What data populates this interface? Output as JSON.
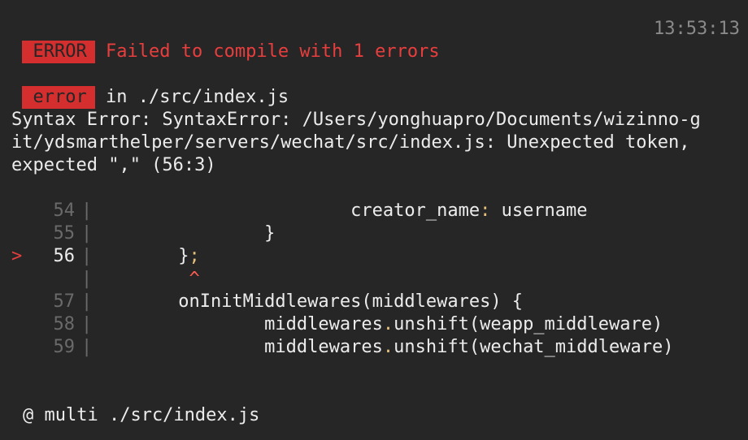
{
  "header": {
    "badge": "ERROR",
    "message": "Failed to compile with 1 errors",
    "timestamp": "13:53:13"
  },
  "location": {
    "badge": "error",
    "text": "in ./src/index.js"
  },
  "error_message": {
    "line1": "Syntax Error: SyntaxError: /Users/yonghuapro/Documents/wizinno-g",
    "line2": "it/ydsmarthelper/servers/wechat/src/index.js: Unexpected token,",
    "line3": "expected \",\" (56:3)"
  },
  "code": {
    "marker": ">",
    "pipe": "|",
    "caret": "^",
    "rows": [
      {
        "num": "54",
        "pre": "                        creator_name",
        "sep": ":",
        "post": " username"
      },
      {
        "num": "55",
        "text": "                }"
      },
      {
        "num": "56",
        "pre": "        }",
        "sep": ";",
        "post": ""
      },
      {
        "num": "57",
        "text": "        onInitMiddlewares(middlewares) {"
      },
      {
        "num": "58",
        "pre": "                middlewares",
        "sep": ".",
        "post": "unshift(weapp_middleware)"
      },
      {
        "num": "59",
        "pre": "                middlewares",
        "sep": ".",
        "post": "unshift(wechat_middleware)"
      }
    ]
  },
  "footer": {
    "text": "@ multi ./src/index.js"
  }
}
